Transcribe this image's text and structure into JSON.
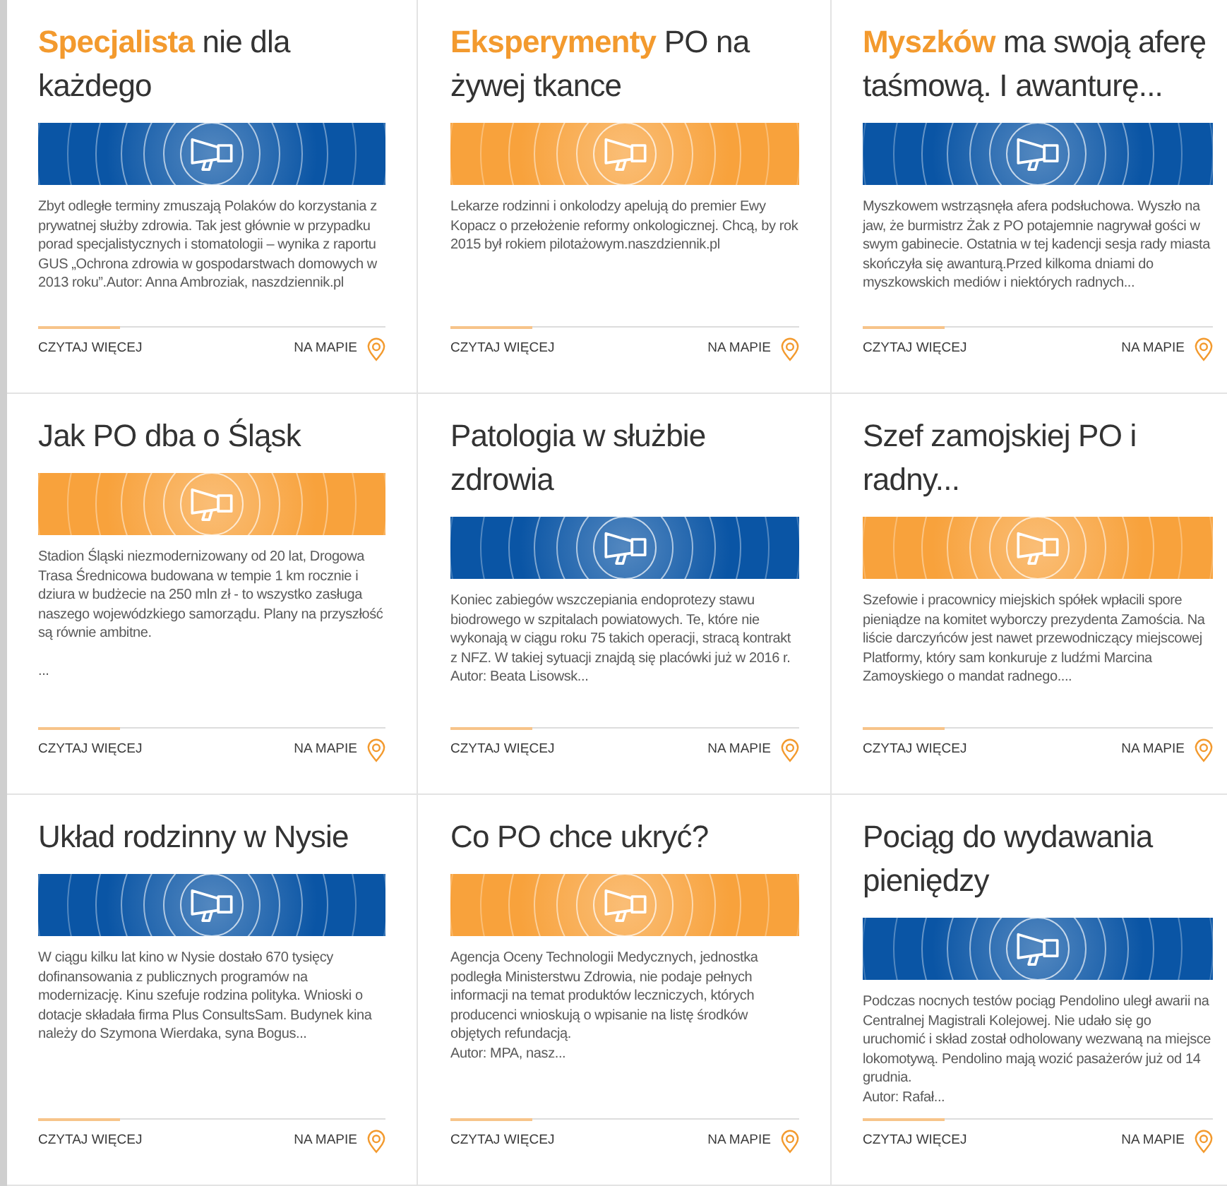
{
  "cards": [
    {
      "title": "**Specjalista** nie dla każdego",
      "banner": {
        "color": "#0a55a5"
      },
      "excerpt": "Zbyt odległe terminy zmuszają Polaków do korzystania z prywatnej służby zdrowia. Tak jest głównie w przypadku porad specjalistycznych i stomatologii – wynika z raportu GUS „Ochrona zdrowia w gospodarstwach domowych w 2013 roku”.Autor: Anna Ambroziak, naszdziennik.pl",
      "read_more": "CZYTAJ WIĘCEJ",
      "map_link": "NA MAPIE"
    },
    {
      "title": "**Eksperymenty** PO na żywej tkance",
      "banner": {
        "color": "#f8a23c"
      },
      "excerpt": "Lekarze rodzinni i onkolodzy apelują do premier Ewy Kopacz o przełożenie reformy onkologicznej. Chcą, by rok 2015 był rokiem pilotażowym.naszdziennik.pl",
      "read_more": "CZYTAJ WIĘCEJ",
      "map_link": "NA MAPIE"
    },
    {
      "title": "**Myszków** ma swoją aferę taśmową. I awanturę...",
      "banner": {
        "color": "#0a55a5"
      },
      "excerpt": "Myszkowem wstrząsnęła afera podsłuchowa. Wyszło na jaw, że burmistrz Żak z PO potajemnie nagrywał gości w swym gabinecie. Ostatnia w tej kadencji sesja rady miasta skończyła się awanturą.Przed kilkoma dniami do myszkowskich mediów i niektórych radnych...",
      "read_more": "CZYTAJ WIĘCEJ",
      "map_link": "NA MAPIE"
    },
    {
      "title": "Jak PO dba o Śląsk",
      "banner": {
        "color": "#f8a23c"
      },
      "excerpt": "Stadion Śląski niezmodernizowany od 20 lat, Drogowa Trasa Średnicowa budowana w tempie 1 km rocznie i dziura w budżecie na 250 mln zł - to wszystko zasługa naszego wojewódzkiego samorządu. Plany na przyszłość są równie ambitne.\n\n...",
      "read_more": "CZYTAJ WIĘCEJ",
      "map_link": "NA MAPIE"
    },
    {
      "title": "Patologia w służbie zdrowia",
      "banner": {
        "color": "#0a55a5"
      },
      "excerpt": "Koniec zabiegów wszczepiania endoprotezy stawu biodrowego w szpitalach powiatowych. Te, które nie wykonają w ciągu roku 75 takich operacji, stracą kontrakt z NFZ. W takiej sytuacji znajdą się placówki już w 2016 r.\nAutor: Beata Lisowsk...",
      "read_more": "CZYTAJ WIĘCEJ",
      "map_link": "NA MAPIE"
    },
    {
      "title": "Szef zamojskiej PO i radny...",
      "banner": {
        "color": "#f8a23c"
      },
      "excerpt": "Szefowie i pracownicy miejskich spółek wpłacili spore pieniądze na komitet wyborczy prezydenta Zamościa. Na liście darczyńców jest nawet przewodniczący miejscowej Platformy, który sam konkuruje z ludźmi Marcina Zamoyskiego o mandat radnego....",
      "read_more": "CZYTAJ WIĘCEJ",
      "map_link": "NA MAPIE"
    },
    {
      "title": "Układ rodzinny w Nysie",
      "banner": {
        "color": "#0a55a5"
      },
      "excerpt": "W ciągu kilku lat kino w Nysie dostało 670 tysięcy dofinansowania z publicznych programów na modernizację. Kinu szefuje rodzina polityka. Wnioski o dotacje składała firma Plus ConsultsSam. Budynek kina należy do Szymona Wierdaka, syna Bogus...",
      "read_more": "CZYTAJ WIĘCEJ",
      "map_link": "NA MAPIE"
    },
    {
      "title": "Co PO chce ukryć?",
      "banner": {
        "color": "#f8a23c"
      },
      "excerpt": "Agencja Oceny Technologii Medycznych, jednostka podległa Ministerstwu Zdrowia, nie podaje pełnych informacji na temat produktów leczniczych, których producenci wnioskują o wpisanie na listę środków objętych refundacją.\nAutor: MPA, nasz...",
      "read_more": "CZYTAJ WIĘCEJ",
      "map_link": "NA MAPIE"
    },
    {
      "title": "Pociąg do wydawania pieniędzy",
      "banner": {
        "color": "#0a55a5"
      },
      "excerpt": "Podczas nocnych testów pociąg Pendolino uległ awarii na Centralnej Magistrali Kolejowej. Nie udało się go uruchomić i skład został odholowany wezwaną na miejsce lokomotywą. Pendolino mają wozić pasażerów już od 14 grudnia.\nAutor: Rafał...",
      "read_more": "CZYTAJ WIĘCEJ",
      "map_link": "NA MAPIE"
    }
  ]
}
